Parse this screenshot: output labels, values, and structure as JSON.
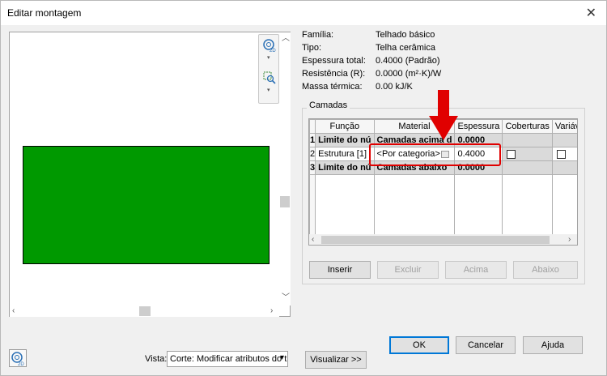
{
  "window": {
    "title": "Editar montagem",
    "close_glyph": "✕"
  },
  "preview": {
    "nav_icons": [
      "zoom-2d-icon",
      "zoom-region-icon"
    ],
    "vista_label": "Vista:",
    "vista_value": "Corte: Modificar atributos do ti",
    "visualizar_label": "Visualizar >>"
  },
  "properties": [
    {
      "label": "Família:",
      "value": "Telhado básico"
    },
    {
      "label": "Tipo:",
      "value": "Telha cerâmica"
    },
    {
      "label": "Espessura total:",
      "value": "0.4000 (Padrão)"
    },
    {
      "label": "Resistência (R):",
      "value": "0.0000 (m²·K)/W"
    },
    {
      "label": "Massa térmica:",
      "value": "0.00 kJ/K"
    }
  ],
  "camadas": {
    "group_label": "Camadas",
    "columns": [
      "Função",
      "Material",
      "Espessura",
      "Coberturas",
      "Variável"
    ],
    "rows": [
      {
        "num": "1",
        "funcao": "Limite do nú",
        "material": "Camadas acima d",
        "espessura": "0.0000"
      },
      {
        "num": "2",
        "funcao": "Estrutura [1]",
        "material": "<Por categoria>",
        "espessura": "0.4000"
      },
      {
        "num": "3",
        "funcao": "Limite do nú",
        "material": "Camadas abaixo",
        "espessura": "0.0000"
      }
    ],
    "buttons": {
      "inserir": "Inserir",
      "excluir": "Excluir",
      "acima": "Acima",
      "abaixo": "Abaixo"
    }
  },
  "footer": {
    "ok": "OK",
    "cancelar": "Cancelar",
    "ajuda": "Ajuda"
  },
  "colors": {
    "preview_fill": "#009900",
    "highlight": "#e00000"
  }
}
